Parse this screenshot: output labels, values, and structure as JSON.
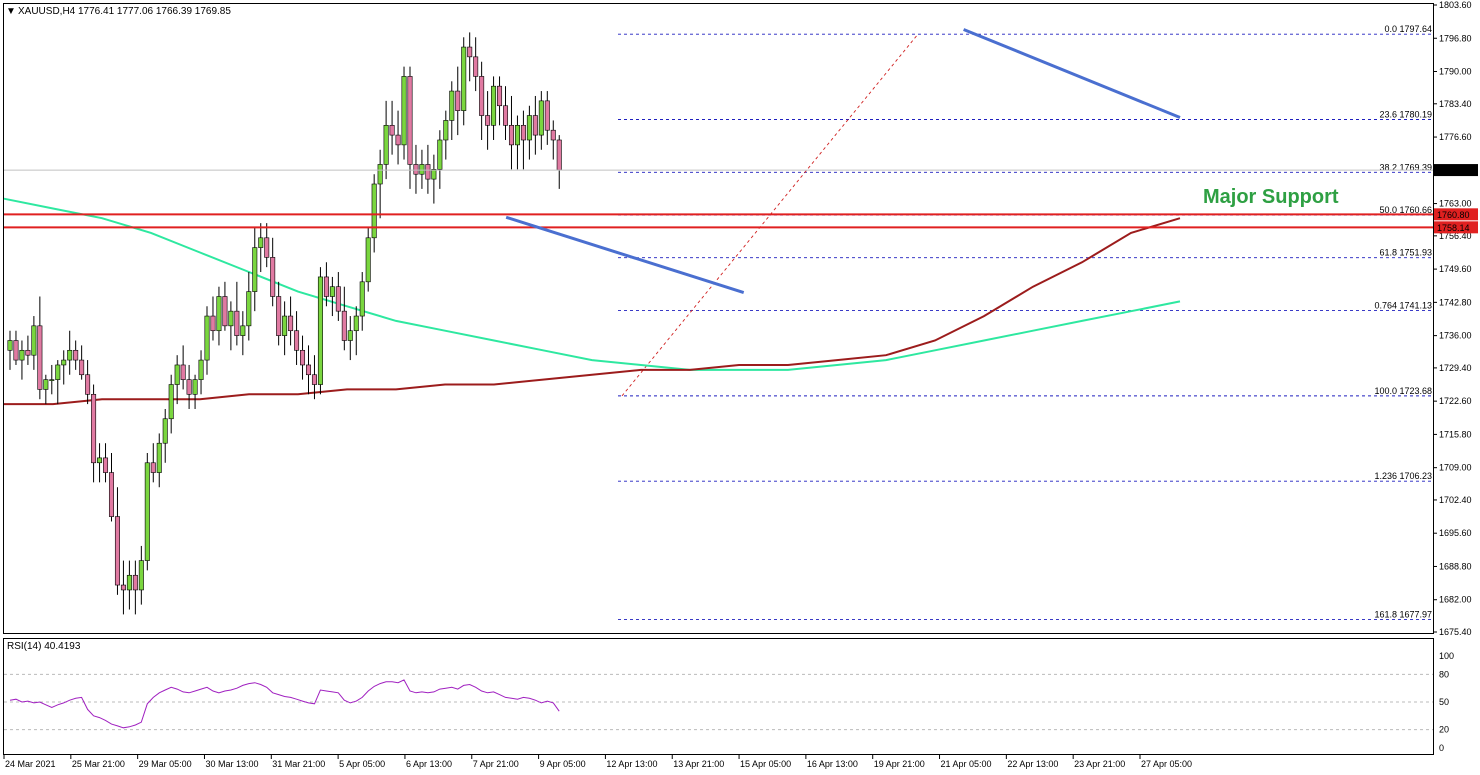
{
  "header": {
    "symbol": "XAUUSD,H4",
    "ohlc": "1776.41 1777.06 1766.39 1769.85"
  },
  "chart_data": {
    "type": "candlestick",
    "symbol": "XAUUSD",
    "timeframe": "H4",
    "title": "XAUUSD,H4  1776.41 1777.06 1766.39 1769.85",
    "ylim": [
      1675.4,
      1803.6
    ],
    "y_ticks": [
      "1803.60",
      "1796.80",
      "1790.00",
      "1783.40",
      "1776.60",
      "1770.00",
      "1763.00",
      "1756.40",
      "1749.60",
      "1742.80",
      "1736.00",
      "1729.40",
      "1722.60",
      "1715.80",
      "1709.00",
      "1702.40",
      "1695.60",
      "1688.80",
      "1682.00",
      "1675.40"
    ],
    "x_ticks": [
      "24 Mar 2021",
      "25 Mar 21:00",
      "29 Mar 05:00",
      "30 Mar 13:00",
      "31 Mar 21:00",
      "5 Apr 05:00",
      "6 Apr 13:00",
      "7 Apr 21:00",
      "9 Apr 05:00",
      "12 Apr 13:00",
      "13 Apr 21:00",
      "15 Apr 05:00",
      "16 Apr 13:00",
      "19 Apr 21:00",
      "21 Apr 05:00",
      "22 Apr 13:00",
      "23 Apr 21:00",
      "27 Apr 05:00"
    ],
    "candles_approx": [
      [
        1733,
        1737,
        1729,
        1735
      ],
      [
        1735,
        1737,
        1730,
        1731
      ],
      [
        1731,
        1735,
        1727,
        1733
      ],
      [
        1733,
        1736,
        1730,
        1732
      ],
      [
        1732,
        1740,
        1729,
        1738
      ],
      [
        1738,
        1744,
        1723,
        1725
      ],
      [
        1725,
        1728,
        1722,
        1727
      ],
      [
        1727,
        1730,
        1724,
        1727
      ],
      [
        1727,
        1731,
        1722,
        1730
      ],
      [
        1730,
        1733,
        1726,
        1731
      ],
      [
        1731,
        1737,
        1728,
        1733
      ],
      [
        1733,
        1735,
        1729,
        1731
      ],
      [
        1731,
        1734,
        1727,
        1728
      ],
      [
        1728,
        1731,
        1722,
        1724
      ],
      [
        1724,
        1726,
        1706,
        1710
      ],
      [
        1710,
        1714,
        1706,
        1711
      ],
      [
        1711,
        1714,
        1706,
        1708
      ],
      [
        1708,
        1712,
        1698,
        1699
      ],
      [
        1699,
        1705,
        1683,
        1685
      ],
      [
        1685,
        1690,
        1679,
        1684
      ],
      [
        1684,
        1690,
        1680,
        1687
      ],
      [
        1687,
        1690,
        1679,
        1684
      ],
      [
        1684,
        1693,
        1681,
        1690
      ],
      [
        1690,
        1712,
        1688,
        1710
      ],
      [
        1710,
        1714,
        1706,
        1708
      ],
      [
        1708,
        1716,
        1705,
        1714
      ],
      [
        1714,
        1721,
        1710,
        1719
      ],
      [
        1719,
        1728,
        1716,
        1726
      ],
      [
        1726,
        1732,
        1722,
        1730
      ],
      [
        1730,
        1734,
        1725,
        1727
      ],
      [
        1727,
        1730,
        1721,
        1724
      ],
      [
        1724,
        1728,
        1721,
        1727
      ],
      [
        1727,
        1733,
        1724,
        1731
      ],
      [
        1731,
        1742,
        1728,
        1740
      ],
      [
        1740,
        1744,
        1735,
        1737
      ],
      [
        1737,
        1746,
        1734,
        1744
      ],
      [
        1744,
        1747,
        1737,
        1738
      ],
      [
        1738,
        1743,
        1733,
        1741
      ],
      [
        1741,
        1747,
        1734,
        1736
      ],
      [
        1736,
        1741,
        1732,
        1738
      ],
      [
        1738,
        1749,
        1735,
        1745
      ],
      [
        1745,
        1758,
        1741,
        1754
      ],
      [
        1754,
        1759,
        1749,
        1756
      ],
      [
        1756,
        1759,
        1750,
        1752
      ],
      [
        1752,
        1756,
        1742,
        1744
      ],
      [
        1744,
        1747,
        1734,
        1736
      ],
      [
        1736,
        1743,
        1732,
        1740
      ],
      [
        1740,
        1744,
        1734,
        1737
      ],
      [
        1737,
        1741,
        1730,
        1733
      ],
      [
        1733,
        1736,
        1727,
        1730
      ],
      [
        1730,
        1734,
        1724,
        1728
      ],
      [
        1728,
        1732,
        1723,
        1726
      ],
      [
        1726,
        1750,
        1724,
        1748
      ],
      [
        1748,
        1751,
        1742,
        1744
      ],
      [
        1744,
        1748,
        1740,
        1746
      ],
      [
        1746,
        1749,
        1739,
        1741
      ],
      [
        1741,
        1746,
        1733,
        1735
      ],
      [
        1735,
        1740,
        1731,
        1737
      ],
      [
        1737,
        1742,
        1732,
        1740
      ],
      [
        1740,
        1749,
        1737,
        1747
      ],
      [
        1747,
        1758,
        1745,
        1756
      ],
      [
        1756,
        1769,
        1753,
        1767
      ],
      [
        1767,
        1774,
        1760,
        1771
      ],
      [
        1771,
        1784,
        1768,
        1779
      ],
      [
        1779,
        1784,
        1773,
        1777
      ],
      [
        1777,
        1782,
        1771,
        1775
      ],
      [
        1775,
        1791,
        1772,
        1789
      ],
      [
        1789,
        1791,
        1766,
        1771
      ],
      [
        1771,
        1775,
        1765,
        1769
      ],
      [
        1769,
        1774,
        1766,
        1771
      ],
      [
        1771,
        1775,
        1765,
        1768
      ],
      [
        1768,
        1773,
        1763,
        1770
      ],
      [
        1770,
        1778,
        1766,
        1776
      ],
      [
        1776,
        1782,
        1772,
        1780
      ],
      [
        1780,
        1788,
        1776,
        1786
      ],
      [
        1786,
        1791,
        1777,
        1782
      ],
      [
        1782,
        1797,
        1779,
        1795
      ],
      [
        1795,
        1798,
        1788,
        1793
      ],
      [
        1793,
        1797,
        1786,
        1789
      ],
      [
        1789,
        1792,
        1776,
        1781
      ],
      [
        1781,
        1786,
        1774,
        1779
      ],
      [
        1779,
        1789,
        1776,
        1787
      ],
      [
        1787,
        1789,
        1779,
        1783
      ],
      [
        1783,
        1787,
        1776,
        1779
      ],
      [
        1779,
        1785,
        1770,
        1775
      ],
      [
        1775,
        1781,
        1770,
        1779
      ],
      [
        1779,
        1782,
        1770,
        1776
      ],
      [
        1776,
        1783,
        1772,
        1781
      ],
      [
        1781,
        1785,
        1773,
        1777
      ],
      [
        1777,
        1786,
        1774,
        1784
      ],
      [
        1784,
        1786,
        1775,
        1778
      ],
      [
        1778,
        1780,
        1772,
        1776
      ],
      [
        1776,
        1777,
        1766,
        1769.85
      ]
    ],
    "ma_100": [
      1722,
      1722,
      1723,
      1723,
      1723,
      1724,
      1724,
      1725,
      1725,
      1726,
      1726,
      1727,
      1728,
      1729,
      1729,
      1730,
      1730,
      1731,
      1732,
      1735,
      1740,
      1746,
      1751,
      1757,
      1760
    ],
    "ma_200": [
      1764,
      1762,
      1760,
      1757,
      1753,
      1749,
      1745,
      1742,
      1739,
      1737,
      1735,
      1733,
      1731,
      1730,
      1729,
      1729,
      1729,
      1730,
      1731,
      1733,
      1735,
      1737,
      1739,
      1741,
      1743
    ],
    "fibonacci": [
      {
        "level": "0.0",
        "price": 1797.64,
        "label": "0.0 1797.64"
      },
      {
        "level": "23.6",
        "price": 1780.19,
        "label": "23.6 1780.19"
      },
      {
        "level": "38.2",
        "price": 1769.39,
        "label": "38.2 1769.39"
      },
      {
        "level": "50.0",
        "price": 1760.66,
        "label": "50.0 1760.66"
      },
      {
        "level": "61.8",
        "price": 1751.93,
        "label": "61.8 1751.93"
      },
      {
        "level": "0.764",
        "price": 1741.13,
        "label": "0.764 1741.13"
      },
      {
        "level": "100.0",
        "price": 1723.68,
        "label": "100.0 1723.68"
      },
      {
        "level": "1.236",
        "price": 1706.23,
        "label": "1.236 1706.23"
      },
      {
        "level": "161.8",
        "price": 1677.97,
        "label": "161.8 1677.97"
      }
    ],
    "support_lines": [
      1760.8,
      1758.14
    ],
    "price_tags": [
      {
        "price": 1769.85,
        "label": "1769.85",
        "style": "current"
      },
      {
        "price": 1760.8,
        "label": "1760.80",
        "style": "red"
      },
      {
        "price": 1758.14,
        "label": "1758.14",
        "style": "red"
      }
    ],
    "annotation": "Major Support",
    "trendlines": [
      {
        "from": [
          0.427,
          1760.2
        ],
        "to": [
          0.629,
          1744.8
        ]
      },
      {
        "from": [
          0.816,
          1798.6
        ],
        "to": [
          1.0,
          1780.6
        ]
      }
    ],
    "rsi": {
      "label": "RSI(14) 40.4193",
      "period": 14,
      "value": 40.4193,
      "ylim": [
        0,
        100
      ],
      "levels": [
        80,
        50,
        20
      ],
      "y_ticks": [
        "100",
        "80",
        "50",
        "20",
        "0"
      ],
      "values": [
        52,
        53,
        50,
        51,
        49,
        50,
        47,
        44,
        47,
        49,
        52,
        54,
        55,
        42,
        35,
        33,
        30,
        26,
        24,
        22,
        23,
        25,
        28,
        48,
        55,
        60,
        63,
        66,
        64,
        61,
        60,
        62,
        64,
        66,
        62,
        60,
        62,
        63,
        65,
        68,
        70,
        71,
        69,
        66,
        60,
        58,
        56,
        55,
        53,
        51,
        49,
        48,
        63,
        62,
        61,
        60,
        52,
        49,
        51,
        55,
        62,
        67,
        70,
        72,
        72,
        71,
        74,
        62,
        60,
        61,
        60,
        61,
        64,
        65,
        66,
        64,
        68,
        69,
        66,
        62,
        60,
        61,
        58,
        55,
        54,
        53,
        55,
        54,
        52,
        49,
        51,
        49,
        40
      ]
    }
  }
}
